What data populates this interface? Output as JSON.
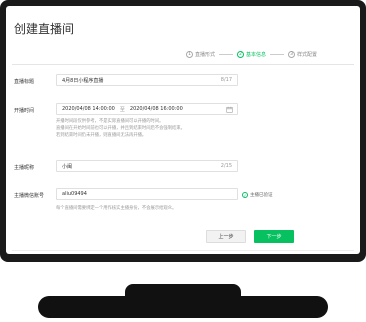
{
  "page": {
    "title": "创建直播间"
  },
  "steps": [
    {
      "num": "1",
      "label": "直播形式"
    },
    {
      "num": "2",
      "label": "基本信息"
    },
    {
      "num": "3",
      "label": "样式配置"
    }
  ],
  "form": {
    "title_label": "直播标题",
    "title_value": "4月8日小程序直播",
    "title_count": "8/17",
    "time_label": "开播时间",
    "start_time": "2020/04/08 14:00:00",
    "time_sep": "至",
    "end_time": "2020/04/08 16:00:00",
    "time_hint_1": "开播时间段仅供参考，不是实际直播间可以开播的时间。",
    "time_hint_2": "直播间在开始时间前也可以开播，并且到结束时间后不会强制结束。",
    "time_hint_3": "若到结束时间仍未开播，则直播间无法再开播。",
    "anchor_label": "主播昵称",
    "anchor_value": "小闽",
    "anchor_count": "2/15",
    "wechat_label": "主播微信账号",
    "wechat_value": "aliu09494",
    "wechat_status": "主播已验证",
    "wechat_hint": "每个直播间需要绑定一个用作核实主播身份，不会展示给观众。"
  },
  "buttons": {
    "prev": "上一步",
    "next": "下一步"
  },
  "colors": {
    "accent": "#07c160",
    "bezel": "#1a1a1a"
  }
}
